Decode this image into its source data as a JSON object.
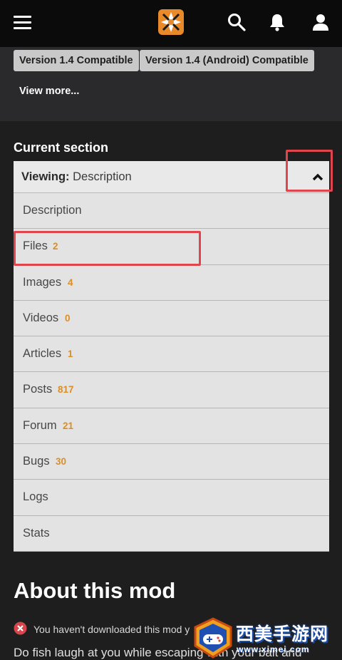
{
  "topbar": {
    "icons": [
      "hamburger-menu-icon",
      "nexus-logo-icon",
      "search-icon",
      "bell-icon",
      "user-icon"
    ]
  },
  "tags": [
    {
      "label": "Version 1.4 Compatible"
    },
    {
      "label": "Version 1.4 (Android) Compatible"
    }
  ],
  "view_more": "View more...",
  "current_section": {
    "label": "Current section",
    "viewing_prefix": "Viewing:",
    "viewing_value": "Description"
  },
  "tabs": [
    {
      "label": "Description",
      "count": ""
    },
    {
      "label": "Files",
      "count": "2"
    },
    {
      "label": "Images",
      "count": "4"
    },
    {
      "label": "Videos",
      "count": "0"
    },
    {
      "label": "Articles",
      "count": "1"
    },
    {
      "label": "Posts",
      "count": "817"
    },
    {
      "label": "Forum",
      "count": "21"
    },
    {
      "label": "Bugs",
      "count": "30"
    },
    {
      "label": "Logs",
      "count": ""
    },
    {
      "label": "Stats",
      "count": ""
    }
  ],
  "about": {
    "title": "About this mod",
    "warning": "You haven't downloaded this mod y",
    "description": "Do fish laugh at you while escaping with your bait and"
  },
  "watermark": {
    "text": "西美手游网",
    "sub": "www.ximei.com"
  },
  "colors": {
    "accent_orange": "#d98e28",
    "highlight_red": "#e0454d",
    "topbar": "#0b0b0c",
    "background": "#1e1e1f"
  }
}
